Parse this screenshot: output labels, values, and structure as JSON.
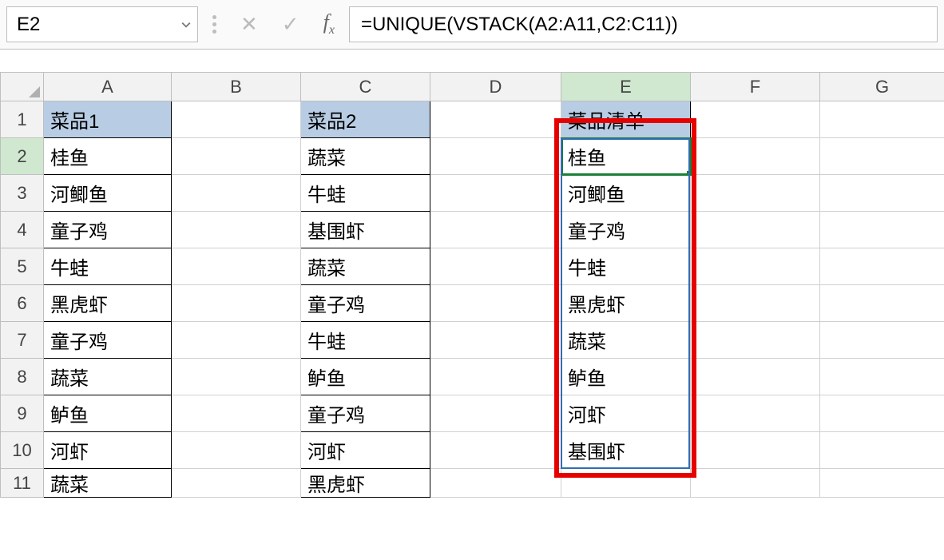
{
  "namebox": {
    "value": "E2"
  },
  "formula": {
    "text": "=UNIQUE(VSTACK(A2:A11,C2:C11))"
  },
  "columns": [
    "A",
    "B",
    "C",
    "D",
    "E",
    "F",
    "G"
  ],
  "headers": {
    "A1": "菜品1",
    "C1": "菜品2",
    "E1": "菜品清单"
  },
  "data": {
    "A": [
      "桂鱼",
      "河鲫鱼",
      "童子鸡",
      "牛蛙",
      "黑虎虾",
      "童子鸡",
      "蔬菜",
      "鲈鱼",
      "河虾",
      "蔬菜"
    ],
    "C": [
      "蔬菜",
      "牛蛙",
      "基围虾",
      "蔬菜",
      "童子鸡",
      "牛蛙",
      "鲈鱼",
      "童子鸡",
      "河虾",
      "黑虎虾"
    ],
    "E": [
      "桂鱼",
      "河鲫鱼",
      "童子鸡",
      "牛蛙",
      "黑虎虾",
      "蔬菜",
      "鲈鱼",
      "河虾",
      "基围虾"
    ]
  },
  "active_cell": "E2",
  "selected_column": "E",
  "selected_row": 2,
  "row_count_visible": 11
}
